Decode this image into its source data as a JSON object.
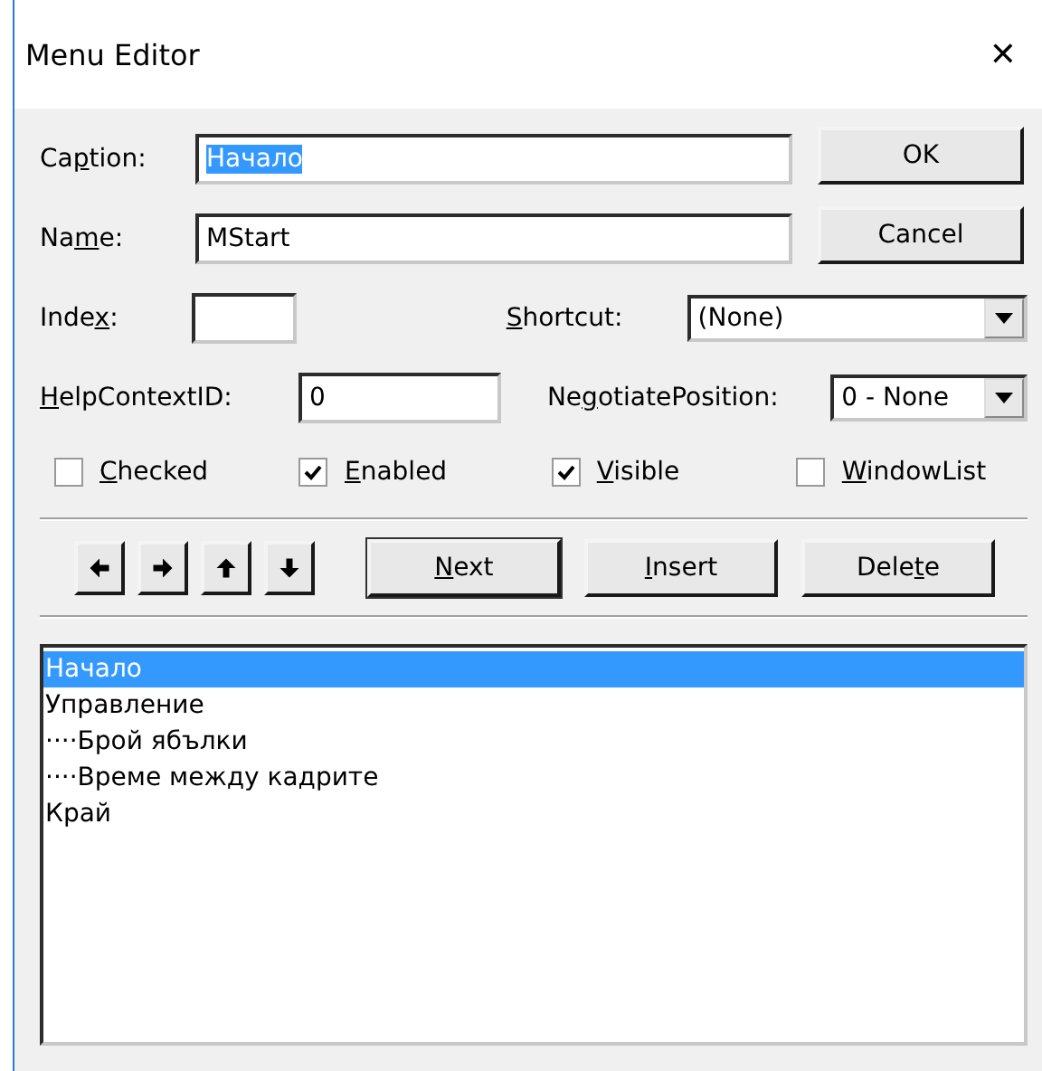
{
  "window": {
    "title": "Menu Editor",
    "close": "✕"
  },
  "caption": {
    "label": {
      "before": "Ca",
      "key": "p",
      "after": "tion:"
    },
    "value": "Начало",
    "value_selected": true
  },
  "name": {
    "label": {
      "before": "Na",
      "key": "m",
      "after": "e:"
    },
    "value": "MStart"
  },
  "index": {
    "label": {
      "before": "Inde",
      "key": "x",
      "after": ":"
    }
  },
  "shortcut": {
    "label": {
      "key": "S",
      "after": "hortcut:"
    },
    "value": "(None)"
  },
  "help_context_id": {
    "label": {
      "key": "H",
      "after": "elpContextID:"
    },
    "value": "0"
  },
  "negotiate_position": {
    "label": {
      "before": "Ne",
      "key": "g",
      "after": "otiatePosition:"
    },
    "value": "0 - None"
  },
  "dialog_buttons": [
    {
      "label": {
        "before": "OK"
      }
    },
    {
      "label": {
        "before": "Cancel"
      }
    }
  ],
  "checkboxes": [
    {
      "label": {
        "key": "C",
        "after": "hecked"
      },
      "checked": false
    },
    {
      "label": {
        "key": "E",
        "after": "nabled"
      },
      "checked": true
    },
    {
      "label": {
        "key": "V",
        "after": "isible"
      },
      "checked": true
    },
    {
      "label": {
        "key": "W",
        "after": "indowList"
      },
      "checked": false
    }
  ],
  "arrow_buttons": [
    {
      "kind": "left"
    },
    {
      "kind": "right"
    },
    {
      "kind": "up"
    },
    {
      "kind": "down"
    }
  ],
  "action_buttons": [
    {
      "label": {
        "key": "N",
        "after": "ext"
      },
      "default": true
    },
    {
      "label": {
        "key": "I",
        "after": "nsert"
      },
      "default": false
    },
    {
      "label": {
        "before": "Dele",
        "key": "t",
        "after": "e"
      },
      "default": false
    }
  ],
  "menu_list": [
    {
      "text": "Начало",
      "selected": true
    },
    {
      "text": "Управление",
      "selected": false
    },
    {
      "text": "····Брой ябълки",
      "selected": false
    },
    {
      "text": "····Време между кадрите",
      "selected": false
    },
    {
      "text": "Край",
      "selected": false
    }
  ]
}
